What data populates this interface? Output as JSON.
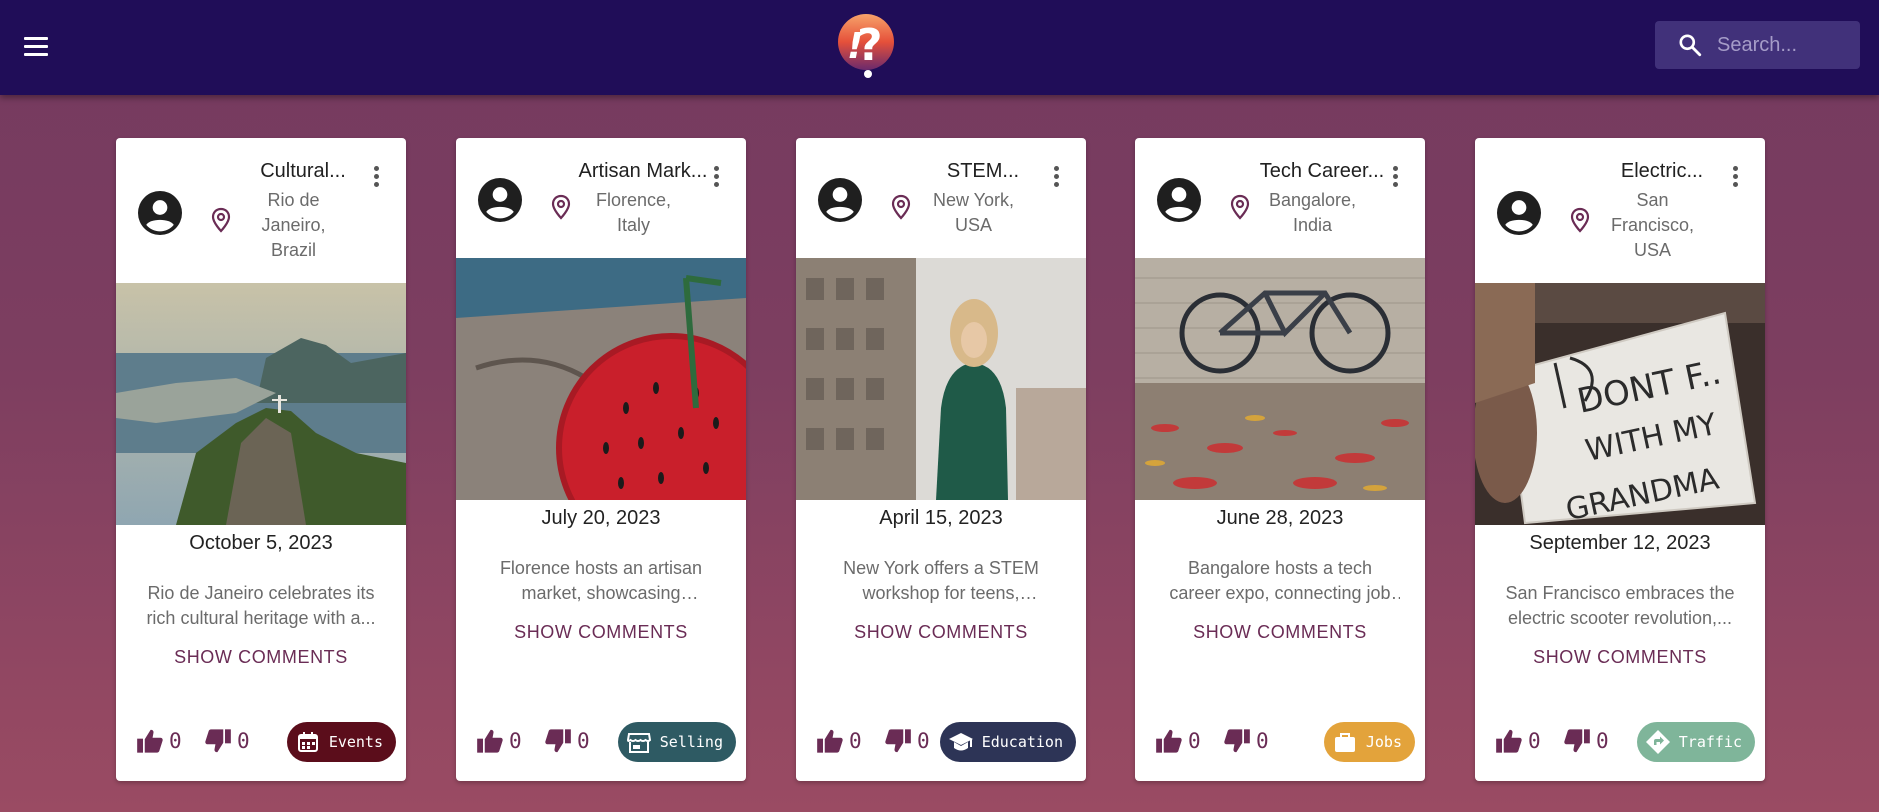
{
  "header": {
    "menu_icon": "menu-icon",
    "logo_icon": "question-exclamation-logo",
    "search": {
      "placeholder": "Search...",
      "icon": "search-icon"
    }
  },
  "colors": {
    "appbar": "#200d58",
    "accent": "#6a2c55",
    "background_top": "#743a5f",
    "background_bottom": "#9a4b63"
  },
  "cards": [
    {
      "title": "Cultural...",
      "location": "Rio de Janeiro, Brazil",
      "date": "October 5, 2023",
      "description": "Rio de Janeiro celebrates its rich cultural heritage with a...",
      "show_comments": "SHOW COMMENTS",
      "likes": "0",
      "dislikes": "0",
      "category": {
        "label": "Events",
        "icon": "calendar-icon",
        "color": "#5b0d1b",
        "text_color": "#ffffff"
      }
    },
    {
      "title": "Artisan Mark...",
      "location": "Florence, Italy",
      "date": "July 20, 2023",
      "description": "Florence hosts an artisan market, showcasing handmad...",
      "show_comments": "SHOW COMMENTS",
      "likes": "0",
      "dislikes": "0",
      "category": {
        "label": "Selling",
        "icon": "store-icon",
        "color": "#2e5a63",
        "text_color": "#ffffff"
      }
    },
    {
      "title": "STEM...",
      "location": "New York, USA",
      "date": "April 15, 2023",
      "description": "New York offers a STEM workshop for teens, inspiring...",
      "show_comments": "SHOW COMMENTS",
      "likes": "0",
      "dislikes": "0",
      "category": {
        "label": "Education",
        "icon": "graduation-cap-icon",
        "color": "#2d3456",
        "text_color": "#ffffff"
      }
    },
    {
      "title": "Tech Career...",
      "location": "Bangalore, India",
      "date": "June 28, 2023",
      "description": "Bangalore hosts a tech career expo, connecting job seekers...",
      "show_comments": "SHOW COMMENTS",
      "likes": "0",
      "dislikes": "0",
      "category": {
        "label": "Jobs",
        "icon": "briefcase-icon",
        "color": "#e3a33b",
        "text_color": "#ffffff"
      }
    },
    {
      "title": "Electric...",
      "location": "San Francisco, USA",
      "date": "September 12, 2023",
      "description": "San Francisco embraces the electric scooter revolution,...",
      "show_comments": "SHOW COMMENTS",
      "likes": "0",
      "dislikes": "0",
      "category": {
        "label": "Traffic",
        "icon": "directions-icon",
        "color": "#7fb59a",
        "text_color": "#ffffff"
      }
    }
  ]
}
